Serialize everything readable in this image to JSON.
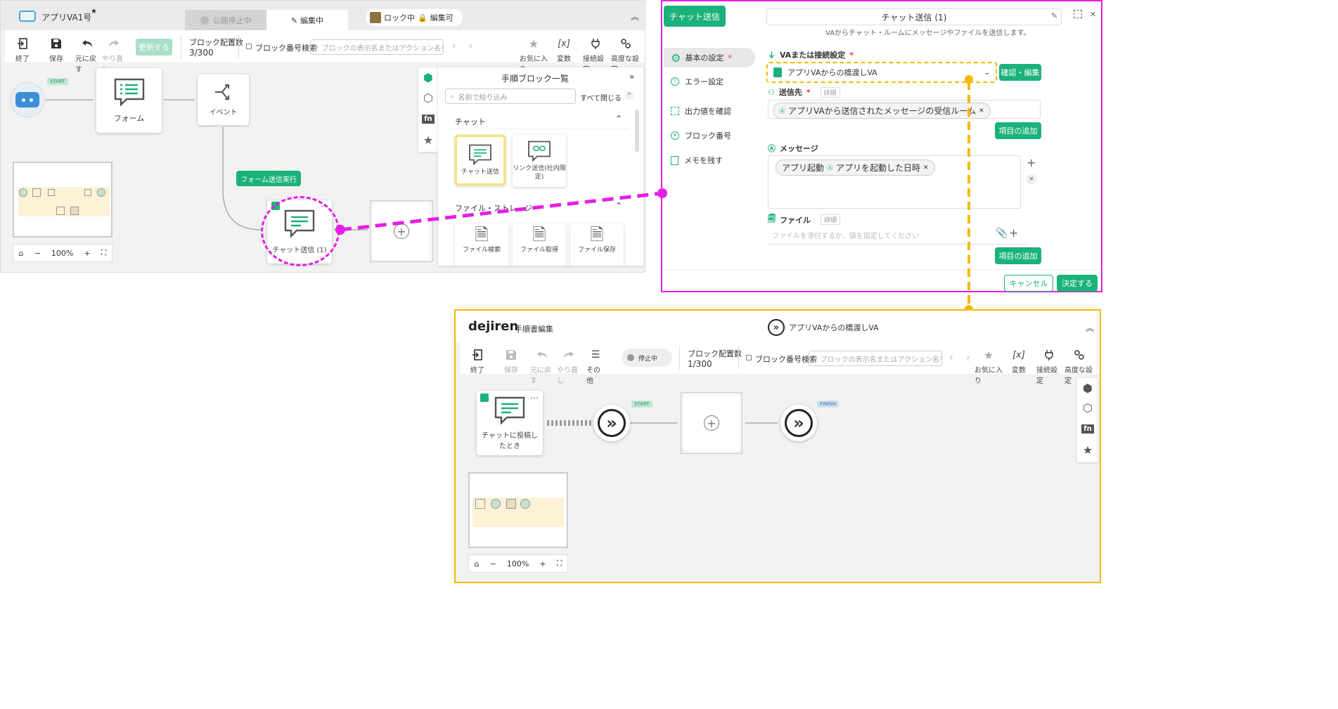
{
  "top_editor": {
    "app_name": "アプリVA1号",
    "star": "★",
    "tab_unpublished": "公開停止中",
    "tab_editing": "編集中",
    "lock_status": "ロック中",
    "edit_status": "編集可",
    "toolbar": {
      "exit": "終了",
      "save": "保存",
      "undo": "元に戻す",
      "redo": "やり直し",
      "update": "更新する",
      "block_count_label": "ブロック配置数",
      "block_count": "3/300",
      "block_number_search": "ブロック番号検索",
      "search_placeholder": "ブロックの表示名またはアクション名を",
      "favorite": "お気に入り",
      "variable": "変数",
      "connection": "接続設定",
      "advanced": "高度な設定",
      "variable_glyph": "[x]"
    },
    "nodes": {
      "start_badge": "START",
      "form": "フォーム",
      "event": "イベント",
      "form_submit": "フォーム送信実行",
      "chat_send": "チャット送信 (1)",
      "more": "…"
    },
    "zoom": {
      "level": "100%",
      "minus": "−",
      "plus": "+"
    },
    "palette": {
      "title": "手順ブロック一覧",
      "filter_placeholder": "名前で絞り込み",
      "collapse_all": "すべて閉じる",
      "fn": "fn",
      "section_chat": "チャット",
      "tile_chat_send": "チャット送信",
      "tile_link_send": "リンク送信(社内限定)",
      "section_file": "ファイル・ストレージ",
      "tile_file_search": "ファイル検索",
      "tile_file_get": "ファイル取得",
      "tile_file_save": "ファイル保存"
    }
  },
  "settings_panel": {
    "header_button": "チャット送信",
    "title": "チャット送信 (1)",
    "description": "VAからチャット・ルームにメッセージやファイルを送信します。",
    "nav": {
      "basic": "基本の設定",
      "basic_required": "*",
      "error": "エラー設定",
      "output": "出力値を確認",
      "block_number": "ブロック番号",
      "memo": "メモを残す"
    },
    "va_label": "VAまたは接続設定",
    "required_mark": "*",
    "va_value": "アプリVAからの橋渡しVA",
    "confirm_edit": "確認・編集",
    "destination_label": "送信先",
    "detail": "詳細",
    "destination_chip": "アプリVAから送信されたメッセージの受信ルーム",
    "add_item": "項目の追加",
    "message_label": "メッセージ",
    "message_chip1": "アプリ起動",
    "message_chip2": "アプリを起動した日時",
    "file_label": "ファイル",
    "file_placeholder": "ファイルを添付するか、値を指定してください",
    "cancel": "キャンセル",
    "ok": "決定する",
    "close_glyph": "✕",
    "plus_glyph": "+"
  },
  "bottom_editor": {
    "logo": "dejiren",
    "subtitle": "手順書編集",
    "flow_title": "アプリVAからの橋渡しVA",
    "toolbar": {
      "exit": "終了",
      "save": "保存",
      "undo": "元に戻す",
      "redo": "やり直し",
      "other": "その他",
      "stopped": "停止中",
      "block_count_label": "ブロック配置数",
      "block_count": "1/300",
      "block_number_search": "ブロック番号検索",
      "search_placeholder": "ブロックの表示名またはアクション名を",
      "favorite": "お気に入り",
      "variable": "変数",
      "connection": "接続設定",
      "advanced": "高度な設定"
    },
    "nodes": {
      "trigger": "チャットに投稿したとき",
      "start_badge": "START",
      "finish_badge": "FINISH"
    },
    "zoom": {
      "level": "100%",
      "minus": "−",
      "plus": "+"
    }
  },
  "colors": {
    "accent_green": "#1bb27a",
    "magenta": "#e61ee6",
    "orange_dash": "#f5b800",
    "highlight_yellow": "#f6e27a"
  }
}
